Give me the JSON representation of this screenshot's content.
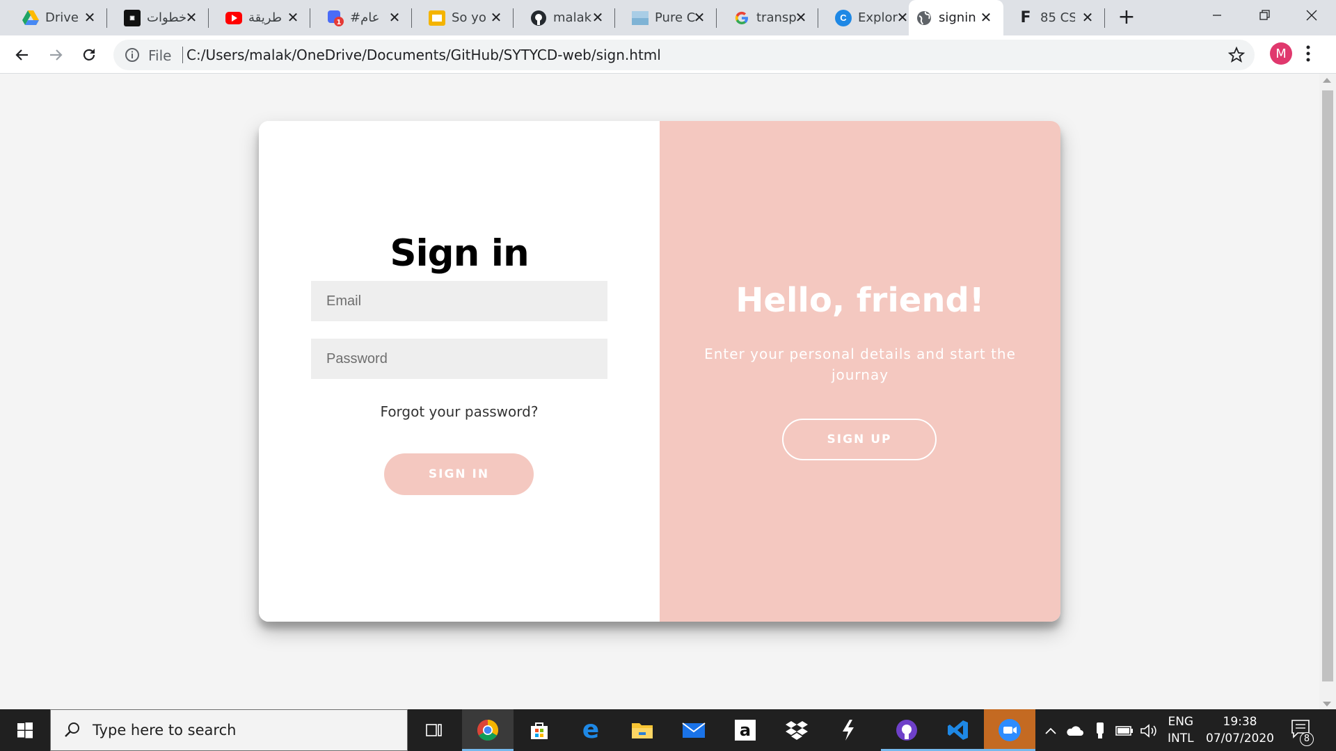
{
  "browser": {
    "tabs": [
      {
        "title": "Drive",
        "icon": "google-drive-icon",
        "color": "#1fa463"
      },
      {
        "title": "خطوات",
        "icon": "site-logo-icon",
        "color": "#111111"
      },
      {
        "title": "طريقة",
        "icon": "youtube-icon",
        "color": "#ff0000"
      },
      {
        "title": "#عام",
        "icon": "chat-app-icon",
        "color": "#4a6cf7"
      },
      {
        "title": "So yo",
        "icon": "google-slides-icon",
        "color": "#f4b400"
      },
      {
        "title": "malak",
        "icon": "github-icon",
        "color": "#24292e"
      },
      {
        "title": "Pure C",
        "icon": "image-site-icon",
        "color": "#7fb3d5"
      },
      {
        "title": "transp",
        "icon": "google-icon",
        "color": "#4285f4"
      },
      {
        "title": "Explor",
        "icon": "c-site-icon",
        "color": "#1e88e5"
      },
      {
        "title": "signin",
        "icon": "globe-icon",
        "color": "#5f6368"
      },
      {
        "title": "85 CS",
        "icon": "f-site-icon",
        "color": "#202124"
      }
    ],
    "active_tab": 9,
    "address": {
      "scheme_label": "File",
      "url": "C:/Users/malak/OneDrive/Documents/GitHub/SYTYCD-web/sign.html"
    },
    "profile_initial": "M",
    "profile_color": "#e0386d"
  },
  "page": {
    "signin": {
      "title": "Sign in",
      "email_placeholder": "Email",
      "password_placeholder": "Password",
      "forgot_text": "Forgot your password?",
      "button_label": "SIGN IN"
    },
    "overlay": {
      "title": "Hello, friend!",
      "text": "Enter your personal details and start the journay",
      "button_label": "SIGN UP",
      "color": "#f4c8c0"
    }
  },
  "taskbar": {
    "search_placeholder": "Type here to search",
    "apps": [
      "task-view",
      "chrome",
      "microsoft-store",
      "edge",
      "file-explorer",
      "mail",
      "amazon",
      "dropbox",
      "lightning-app",
      "github-desktop",
      "vscode",
      "zoom"
    ],
    "language_top": "ENG",
    "language_bottom": "INTL",
    "time": "19:38",
    "date": "07/07/2020",
    "notification_count": "8"
  }
}
